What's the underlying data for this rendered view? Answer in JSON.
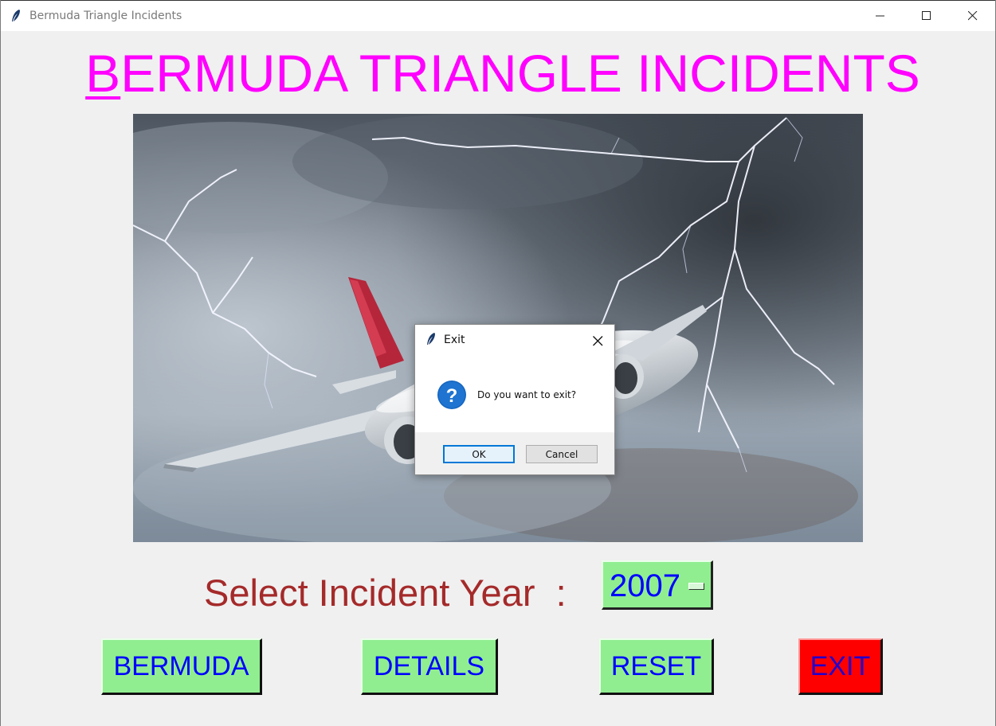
{
  "window": {
    "title": "Bermuda Triangle Incidents"
  },
  "main": {
    "heading_first": "B",
    "heading_rest": "ERMUDA TRIANGLE INCIDENTS",
    "image_alt": "Airplane flying through lightning storm",
    "year_label": "Select Incident Year  :",
    "year_value": "2007"
  },
  "buttons": {
    "bermuda": "BERMUDA",
    "details": "DETAILS",
    "reset": "RESET",
    "exit": "EXIT"
  },
  "dialog": {
    "title": "Exit",
    "message": "Do you want to exit?",
    "ok_label": "OK",
    "cancel_label": "Cancel",
    "icon": "question-icon"
  },
  "colors": {
    "heading": "#ff00ff",
    "year_label": "#a52a2a",
    "button_bg": "#90ee90",
    "button_text": "#0000ff",
    "exit_bg": "#ff0000"
  }
}
